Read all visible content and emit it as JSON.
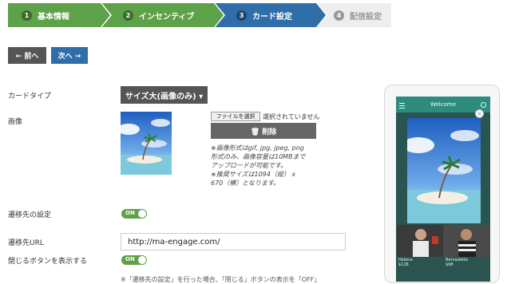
{
  "steps": [
    {
      "num": "1",
      "label": "基本情報"
    },
    {
      "num": "2",
      "label": "インセンティブ"
    },
    {
      "num": "3",
      "label": "カード設定"
    },
    {
      "num": "4",
      "label": "配信設定"
    }
  ],
  "nav": {
    "prev_label": "← 前へ",
    "next_label": "次へ →"
  },
  "form": {
    "card_type_label": "カードタイプ",
    "card_type_value": "サイズ大(画像のみ) ▾",
    "image_label": "画像",
    "file_button": "ファイルを選択",
    "file_status": "選択されていません",
    "delete_button": "🗑 削除",
    "notes": [
      "※画像形式はgif, jpg, jpeg, png",
      "形式のみ、画像容量は10MBまで",
      "アップロードが可能です。",
      "※推奨サイズは1094（縦） x",
      "670（横）となります。"
    ],
    "link_setting_label": "遷移先の設定",
    "toggle_on": "ON",
    "url_label": "遷移先URL",
    "url_value": "http://ma-engage.com/",
    "close_button_label": "閉じるボタンを表示する",
    "bottom_note": "※「遷移先の設定」を行った場合、「閉じる」ボタンの表示を「OFF」"
  },
  "preview": {
    "app_title": "Welcome",
    "close_symbol": "×",
    "product1_name": "Helena",
    "product1_price": "$128",
    "product2_name": "Bernadette",
    "product2_price": "$98"
  },
  "colors": {
    "green": "#5da148",
    "blue": "#2f6ea8",
    "dark": "#555555",
    "teal": "#2e8b7e"
  }
}
